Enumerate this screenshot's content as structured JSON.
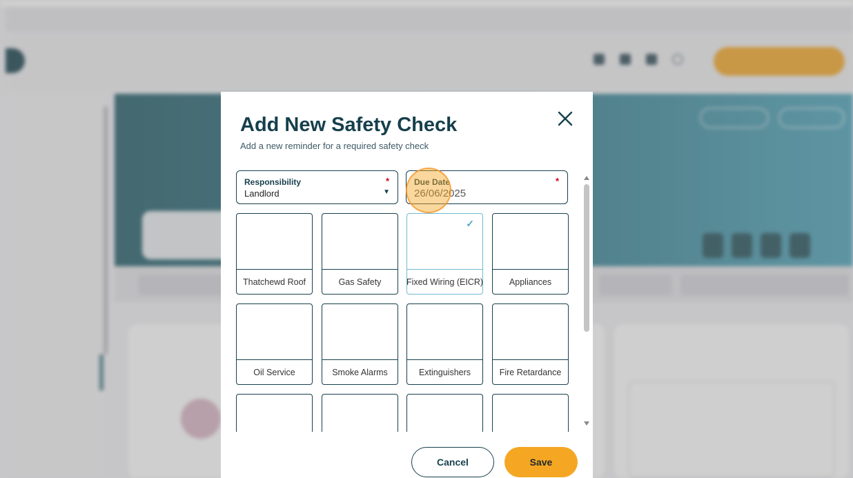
{
  "modal": {
    "title": "Add New Safety Check",
    "subtitle": "Add a new reminder for a required safety check",
    "close_icon": "close-icon",
    "responsibility": {
      "label": "Responsibility",
      "value": "Landlord",
      "required_mark": "*"
    },
    "due_date": {
      "label": "Due Date",
      "value": "26/06/2025",
      "required_mark": "*"
    },
    "check_types": [
      {
        "label": "Thatchewd Roof",
        "selected": false
      },
      {
        "label": "Gas Safety",
        "selected": false
      },
      {
        "label": "Fixed Wiring (EICR)",
        "selected": true
      },
      {
        "label": "Appliances",
        "selected": false
      },
      {
        "label": "Oil Service",
        "selected": false
      },
      {
        "label": "Smoke Alarms",
        "selected": false
      },
      {
        "label": "Extinguishers",
        "selected": false
      },
      {
        "label": "Fire Retardance",
        "selected": false
      },
      {
        "label": "",
        "selected": false
      },
      {
        "label": "",
        "selected": false
      },
      {
        "label": "",
        "selected": false
      },
      {
        "label": "",
        "selected": false
      }
    ],
    "selected_check_mark": "✓",
    "buttons": {
      "cancel": "Cancel",
      "save": "Save"
    }
  },
  "colors": {
    "brand_dark": "#163f4c",
    "accent_orange": "#f5a623",
    "selected_tile": "#6fbad3",
    "required": "#d0021b"
  }
}
